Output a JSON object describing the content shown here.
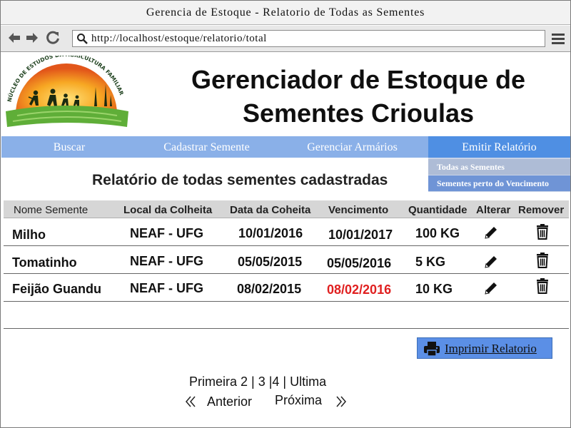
{
  "browser": {
    "window_title": "Gerencia de Estoque - Relatorio de Todas as Sementes",
    "url": "http://localhost/estoque/relatorio/total"
  },
  "header": {
    "logo_text": "NÚCLEO DE ESTUDOS DA AGRICULTURA FAMILIAR",
    "title_line1": "Gerenciador de Estoque de",
    "title_line2": "Sementes Crioulas"
  },
  "nav": {
    "items": [
      {
        "label": "Buscar"
      },
      {
        "label": "Cadastrar Semente"
      },
      {
        "label": "Gerenciar Armários"
      },
      {
        "label": "Emitir Relatório"
      }
    ],
    "dropdown": [
      {
        "label": "Todas as Sementes"
      },
      {
        "label": "Sementes perto do Vencimento"
      }
    ]
  },
  "report": {
    "title": "Relatório de todas sementes cadastradas",
    "columns": [
      "Nome Semente",
      "Local da Colheita",
      "Data da Coheita",
      "Vencimento",
      "Quantidade",
      "Alterar",
      "Remover"
    ],
    "rows": [
      {
        "nome": "Milho",
        "local": "NEAF - UFG",
        "colheita": "10/01/2016",
        "vencimento": "10/01/2017",
        "quantidade": "100 KG",
        "expired": false
      },
      {
        "nome": "Tomatinho",
        "local": "NEAF - UFG",
        "colheita": "05/05/2015",
        "vencimento": "05/05/2016",
        "quantidade": "5 KG",
        "expired": false
      },
      {
        "nome": "Feijão Guandu",
        "local": "NEAF - UFG",
        "colheita": "08/02/2015",
        "vencimento": "08/02/2016",
        "quantidade": "10 KG",
        "expired": true
      }
    ]
  },
  "actions": {
    "print_label": "Imprimir Relatorio"
  },
  "pagination": {
    "pages_text": "Primeira 2 | 3 |4 | Ultima",
    "previous": "Anterior",
    "next": "Próxima"
  },
  "colors": {
    "nav_bg": "#8ab0e8",
    "nav_active": "#4f8fe3",
    "expired_date": "#e02020",
    "print_button": "#5b8fe6"
  }
}
